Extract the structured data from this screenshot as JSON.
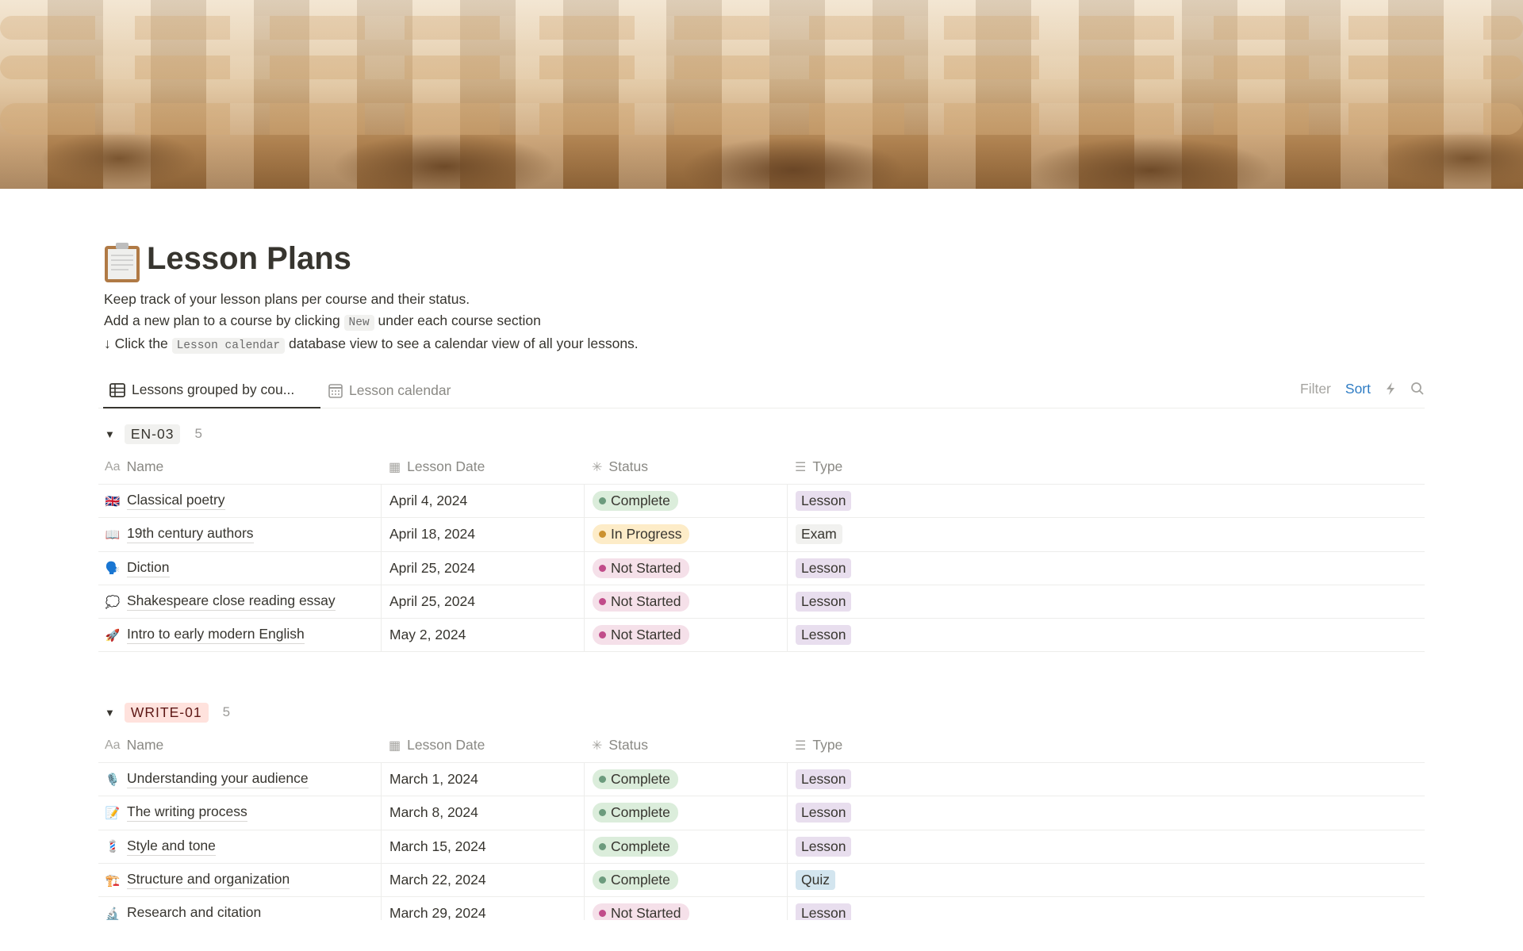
{
  "page": {
    "icon": "clipboard-icon",
    "title": "Lesson Plans",
    "description": {
      "line1": "Keep track of your lesson plans per course and their status.",
      "line2_before": "Add a new plan to a course by clicking",
      "line2_code": "New",
      "line2_after": "under each course section",
      "line3_before": "↓ Click the",
      "line3_code": "Lesson calendar",
      "line3_after": "database view to see a calendar view of all your lessons."
    }
  },
  "tabs": [
    {
      "label": "Lessons grouped by cou...",
      "icon": "table-icon",
      "active": true
    },
    {
      "label": "Lesson calendar",
      "icon": "calendar-icon",
      "active": false
    }
  ],
  "toolbar": {
    "filter": "Filter",
    "sort": "Sort",
    "automation_icon": "lightning-icon",
    "search_icon": "search-icon"
  },
  "columns": {
    "name": "Name",
    "date": "Lesson Date",
    "status": "Status",
    "type": "Type"
  },
  "colors": {
    "complete_bg": "#dbeddb",
    "complete_dot": "#6c9b7d",
    "progress_bg": "#fdecc8",
    "progress_dot": "#cb912f",
    "notstarted_bg": "#f5e0e9",
    "notstarted_dot": "#c14c8a",
    "lesson_bg": "#e8deee",
    "exam_bg": "#f1f1ef",
    "quiz_bg": "#d3e5ef",
    "en_bg": "#f1f1ef",
    "write_bg": "#ffe2dd",
    "write_fg": "#5d1715"
  },
  "groups": [
    {
      "tag": "EN-03",
      "count": "5",
      "rows": [
        {
          "emoji": "🇬🇧",
          "name": "Classical poetry",
          "date": "April 4, 2024",
          "status": "Complete",
          "type": "Lesson"
        },
        {
          "emoji": "📖",
          "name": "19th century authors",
          "date": "April 18, 2024",
          "status": "In Progress",
          "type": "Exam"
        },
        {
          "emoji": "🗣️",
          "name": "Diction",
          "date": "April 25, 2024",
          "status": "Not Started",
          "type": "Lesson"
        },
        {
          "emoji": "💭",
          "name": "Shakespeare close reading essay",
          "date": "April 25, 2024",
          "status": "Not Started",
          "type": "Lesson"
        },
        {
          "emoji": "🚀",
          "name": "Intro to early modern English",
          "date": "May 2, 2024",
          "status": "Not Started",
          "type": "Lesson"
        }
      ]
    },
    {
      "tag": "WRITE-01",
      "count": "5",
      "rows": [
        {
          "emoji": "🎙️",
          "name": "Understanding your audience",
          "date": "March 1, 2024",
          "status": "Complete",
          "type": "Lesson"
        },
        {
          "emoji": "📝",
          "name": "The writing process",
          "date": "March 8, 2024",
          "status": "Complete",
          "type": "Lesson"
        },
        {
          "emoji": "💈",
          "name": "Style and tone",
          "date": "March 15, 2024",
          "status": "Complete",
          "type": "Lesson"
        },
        {
          "emoji": "🏗️",
          "name": "Structure and organization",
          "date": "March 22, 2024",
          "status": "Complete",
          "type": "Quiz"
        },
        {
          "emoji": "🔬",
          "name": "Research and citation",
          "date": "March 29, 2024",
          "status": "Not Started",
          "type": "Lesson"
        }
      ]
    }
  ]
}
